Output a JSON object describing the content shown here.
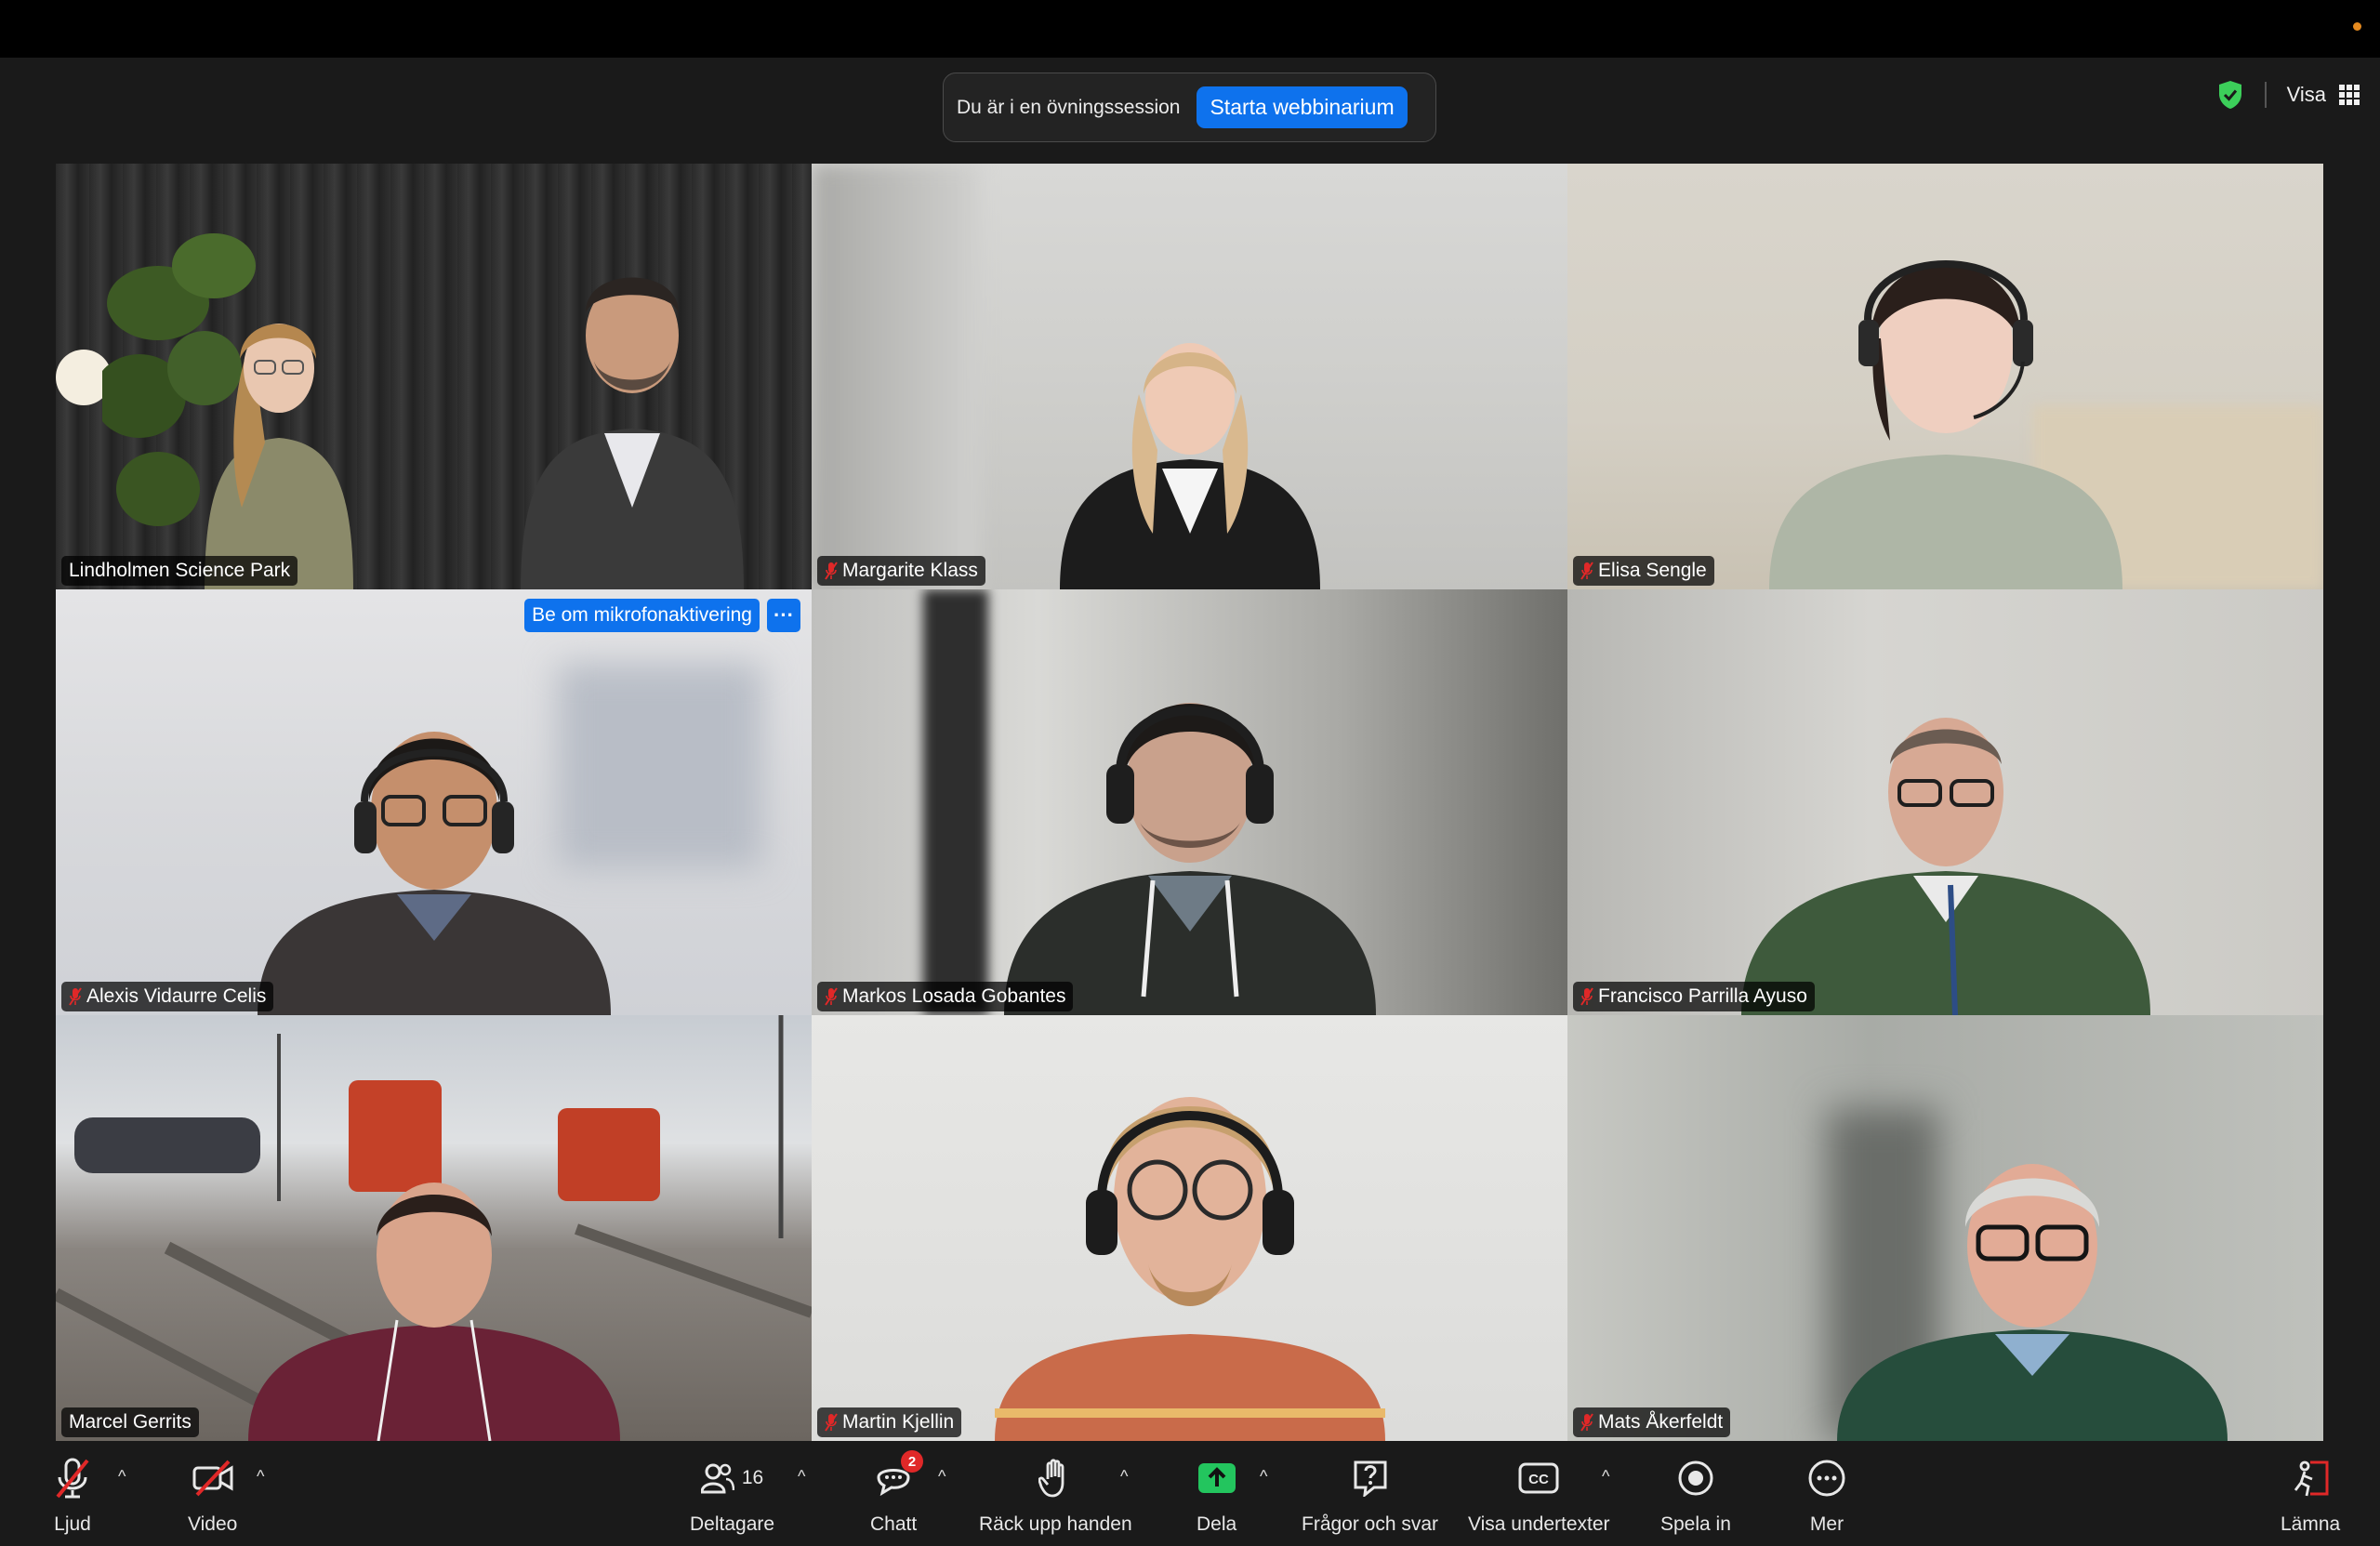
{
  "practice_banner": {
    "text": "Du är i en övningssession",
    "start_button": "Starta webbinarium"
  },
  "top_right": {
    "view_label": "Visa"
  },
  "tiles": [
    {
      "name": "Lindholmen Science Park",
      "muted": false,
      "active": true
    },
    {
      "name": "Margarite Klass",
      "muted": true
    },
    {
      "name": "Elisa Sengle",
      "muted": true
    },
    {
      "name": "Alexis Vidaurre Celis",
      "muted": true,
      "action": "Be om mikrofonaktivering"
    },
    {
      "name": "Markos Losada Gobantes",
      "muted": true
    },
    {
      "name": "Francisco Parrilla Ayuso",
      "muted": true
    },
    {
      "name": "Marcel Gerrits",
      "muted": false
    },
    {
      "name": "Martin Kjellin",
      "muted": true
    },
    {
      "name": "Mats Åkerfeldt",
      "muted": true
    }
  ],
  "toolbar": {
    "audio": "Ljud",
    "video": "Video",
    "participants": "Deltagare",
    "participants_count": "16",
    "chat": "Chatt",
    "chat_badge": "2",
    "raise_hand": "Räck upp handen",
    "share": "Dela",
    "qa": "Frågor och svar",
    "captions": "Visa undertexter",
    "record": "Spela in",
    "more": "Mer",
    "leave": "Lämna"
  },
  "colors": {
    "accent_blue": "#0e72ed",
    "active_speaker": "#4cc94a",
    "muted_red": "#e02828",
    "share_green": "#23c55e"
  }
}
